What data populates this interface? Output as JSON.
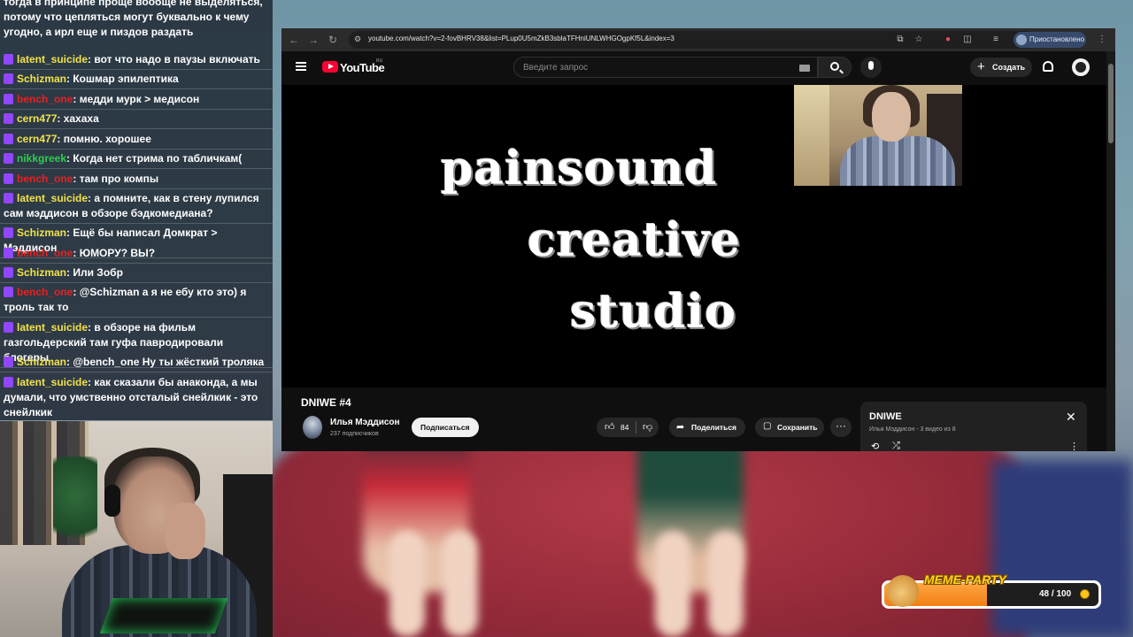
{
  "chat": {
    "top_text": "тогда в принципе проще вообще не выделяться, потому что цепляться могут буквально к чему угодно, а ирл еще и пиздов раздать",
    "messages": [
      {
        "user": "latent_suicide",
        "text": ": вот что надо в паузы включать",
        "color": "yellow"
      },
      {
        "user": "Schizman",
        "text": ": Кошмар эпилептика",
        "color": "yellow"
      },
      {
        "user": "bench_one",
        "text": ": медди мурк > медисон",
        "color": "red"
      },
      {
        "user": "cern477",
        "text": ": хахаха",
        "color": "yellow"
      },
      {
        "user": "cern477",
        "text": ": помню. хорошее",
        "color": "yellow"
      },
      {
        "user": "nikkgreek",
        "text": ": Когда нет стрима по табличкам(",
        "color": "green"
      },
      {
        "user": "bench_one",
        "text": ": там про компы",
        "color": "red"
      },
      {
        "user": "latent_suicide",
        "text": ": а помните, как в стену лупился сам мэддисон в обзоре бэдкомедиана?",
        "color": "yellow"
      },
      {
        "user": "Schizman",
        "text": ": Ещё бы написал Домкрат > Мэддисон",
        "color": "yellow"
      },
      {
        "user": "bench_one",
        "text": ": ЮМОРУ? ВЫ?",
        "color": "red"
      },
      {
        "user": "Schizman",
        "text": ": Или Зобр",
        "color": "yellow"
      },
      {
        "user": "bench_one",
        "text": ": @Schizman а я не ебу кто это) я троль так то",
        "color": "red"
      },
      {
        "user": "latent_suicide",
        "text": ": в обзоре на фильм газгольдерский там гуфа павродировали блогеры",
        "color": "yellow"
      },
      {
        "user": "Schizman",
        "text": ": @bench_one Ну ты жёсткий троляка",
        "color": "yellow"
      },
      {
        "user": "latent_suicide",
        "text": ": как сказали бы анаконда, а мы думали, что умственно отсталый снейлкик - это снейлкик",
        "color": "yellow"
      }
    ]
  },
  "browser": {
    "url": "youtube.com/watch?v=2-fovBHRV38&list=PLup0U5mZkB3sblaTFHniUNLWHGOgpKf5L&index=3",
    "paused_label": "Приостановлено",
    "icons": [
      "back-icon",
      "forward-icon",
      "reload-icon",
      "site-info-icon",
      "install-icon",
      "star-icon",
      "extension-icon",
      "puzzle-icon",
      "reading-list-icon",
      "menu-icon"
    ]
  },
  "youtube": {
    "logo_text": "YouTube",
    "region": "RU",
    "search_placeholder": "Введите запрос",
    "create_label": "Создать",
    "video_lines": [
      "painsound",
      "creative",
      "studio"
    ],
    "title": "DNIWE #4",
    "channel_name": "Илья Мэддисон",
    "channel_subs": "237 подписчиков",
    "subscribe_label": "Подписаться",
    "like_count": "84",
    "share_label": "Поделиться",
    "save_label": "Сохранить",
    "more_label": "···",
    "playlist": {
      "title": "DNIWE",
      "subtitle": "Илья Мэддисон - 3 видео из 8"
    }
  },
  "meme_party": {
    "title": "MEME-PARTY",
    "count": "48 / 100",
    "progress_fraction": 0.48
  },
  "colors": {
    "username_yellow": "#f2e24a",
    "username_red": "#e82020",
    "username_green": "#2ecc50",
    "youtube_red": "#ff0033",
    "twitch_badge": "#9146ff"
  }
}
